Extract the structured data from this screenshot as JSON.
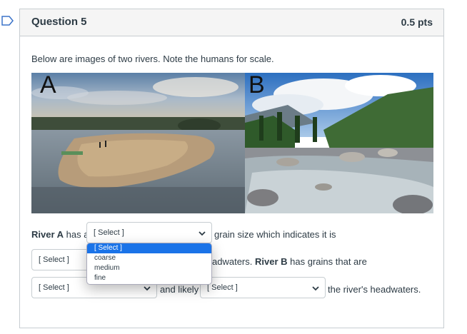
{
  "question": {
    "title": "Question 5",
    "points": "0.5 pts",
    "prompt": "Below are images of two rivers. Note the humans for scale."
  },
  "images": {
    "a_label": "A",
    "b_label": "B"
  },
  "sentence": {
    "river_a": "River A",
    "has_a": "has a",
    "grain_size_text": "grain size which indicates it is",
    "headwaters_fragment": "adwaters.",
    "river_b": "River B",
    "has_grains_text": "has grains that are",
    "and_likely": "and likely",
    "rivers_headwaters": "the river's headwaters."
  },
  "selects": {
    "select1": "[ Select ]",
    "select2": "[ Select ]",
    "select3": "[ Select ]",
    "select4": "[ Select ]"
  },
  "dropdown": {
    "options": [
      "[ Select ]",
      "coarse",
      "medium",
      "fine"
    ],
    "highlighted_index": 0
  },
  "icons": {
    "flag": "bookmark-flag-icon",
    "chevron": "chevron-down-icon"
  },
  "colors": {
    "highlight": "#1a73e8",
    "flag": "#3b73c9"
  }
}
